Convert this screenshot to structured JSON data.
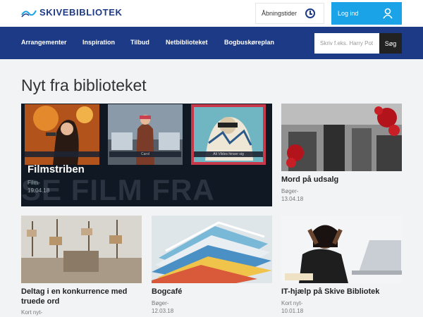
{
  "header": {
    "logo_text": "SKIVEBIBLIOTEK",
    "hours_label": "Åbningstider",
    "login_label": "Log ind"
  },
  "nav": {
    "items": [
      "Arrangementer",
      "Inspiration",
      "Tilbud",
      "Netbiblioteket",
      "Bogbuskøreplan"
    ],
    "search_placeholder": "Skriv f.eks. Harry Pot",
    "search_button": "Søg"
  },
  "main": {
    "title": "Nyt fra biblioteket",
    "featured": {
      "title": "Filmstriben",
      "category": "Film-",
      "date": "19.04.18",
      "background_text": "SE FILM FRA",
      "poster_captions": [
        "",
        "Carol",
        "Alt Vildes hinser sig"
      ]
    },
    "cards": [
      {
        "title": "Mord på udsalg",
        "category": "Bøger-",
        "date": "13.04.18"
      },
      {
        "title": "Deltag i en konkurrence med truede ord",
        "category": "Kort nyt-",
        "date": ""
      },
      {
        "title": "Bogcafé",
        "category": "Bøger-",
        "date": "12.03.18"
      },
      {
        "title": "IT-hjælp på Skive Bibliotek",
        "category": "Kort nyt-",
        "date": "10.01.18"
      }
    ]
  },
  "colors": {
    "brand": "#1d3a86",
    "login": "#1aa3e6",
    "background": "#f2f3f5"
  }
}
